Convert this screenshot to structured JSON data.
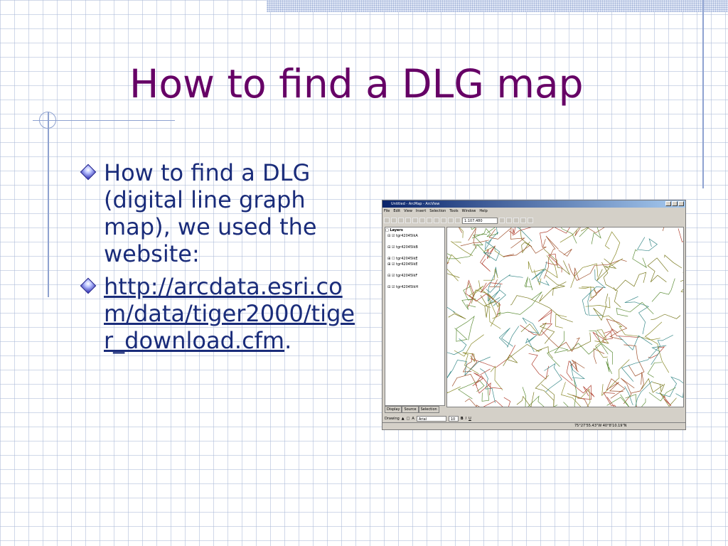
{
  "slide": {
    "title": "How to find a DLG map",
    "bullets": [
      {
        "text": "How to find a DLG (digital line graph map), we used the website:"
      },
      {
        "link": "http://arcdata.esri.com/data/tiger2000/tiger_download.cfm",
        "suffix": "."
      }
    ],
    "colors": {
      "title": "#660066",
      "body": "#1a2c7a",
      "grid": "#aab9d7"
    }
  },
  "screenshot": {
    "window_title": "Untitled - ArcMap - ArcView",
    "menu": [
      "File",
      "Edit",
      "View",
      "Insert",
      "Selection",
      "Tools",
      "Window",
      "Help"
    ],
    "scale": "1:107,480",
    "toc": {
      "root": "Layers",
      "layers": [
        "tgr42045lkA",
        "tgr42045lkB",
        "tgr42045lkE",
        "tgr42045lkE",
        "tgr42045lkF",
        "tgr42045lkH"
      ]
    },
    "tabs": [
      "Display",
      "Source",
      "Selection"
    ],
    "drawing_label": "Drawing",
    "font_name": "Arial",
    "font_size": "10",
    "coordinates": "75°27'55.43\"W  40°8'10.19\"N"
  }
}
